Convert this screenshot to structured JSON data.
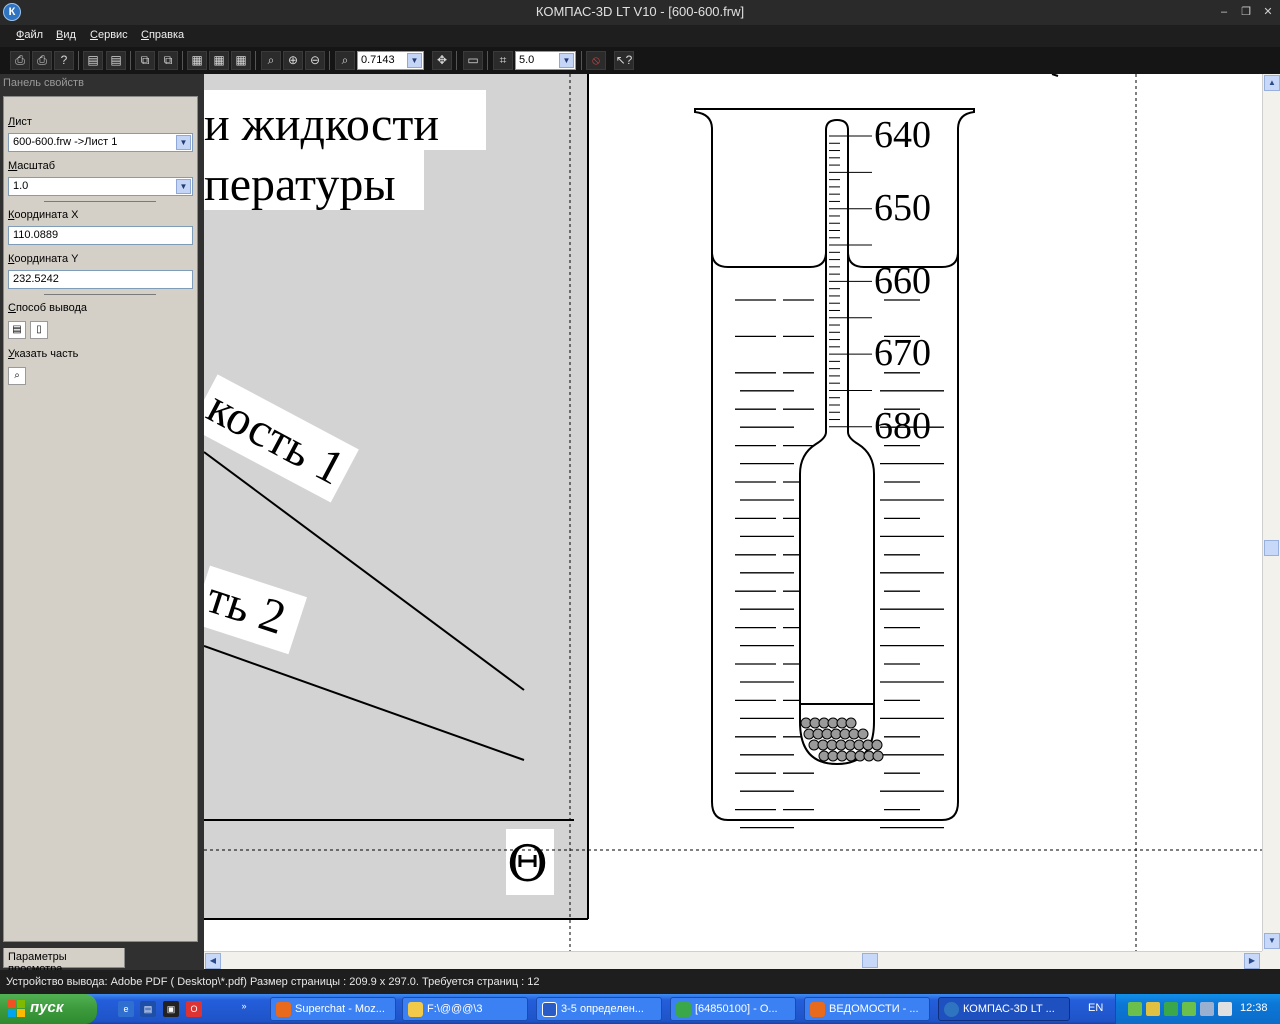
{
  "window": {
    "title": "КОМПАС-3D LT V10 - [600-600.frw]",
    "icon_text": "К",
    "controls": [
      "minimize-icon",
      "restore-icon",
      "close-icon"
    ]
  },
  "menu": [
    "Файл",
    "Вид",
    "Сервис",
    "Справка"
  ],
  "toolbar": {
    "zoom_value": "0.7143",
    "step_value": "5.0"
  },
  "panel": {
    "title": "Панель свойств",
    "sheet_label": "Лист",
    "sheet_value": "600-600.frw ->Лист 1",
    "scale_label": "Масштаб",
    "scale_value": "1.0",
    "coord_x_label": "Координата X",
    "coord_x_value": "110.0889",
    "coord_y_label": "Координата Y",
    "coord_y_value": "232.5242",
    "output_label": "Способ вывода",
    "part_label": "Указать часть",
    "tab_label": "Параметры просмотра"
  },
  "drawing": {
    "text_line1": "и жидкости",
    "text_line2": "пературы",
    "label_liquid1": "кость 1",
    "label_liquid2": "ть 2",
    "symbol": "Θ",
    "scale_marks": [
      "640",
      "650",
      "660",
      "670",
      "680"
    ]
  },
  "status": {
    "text": "Устройство вывода: Adobe PDF ( Desktop\\*.pdf)  Размер страницы : 209.9 x 297.0.  Требуется страниц : 12"
  },
  "taskbar": {
    "start_label": "пуск",
    "tasks": [
      {
        "label": "Superchat - Moz...",
        "color": "#e86a1c"
      },
      {
        "label": "F:\\@@@\\3",
        "color": "#f3c94a"
      },
      {
        "label": "3-5 определен...",
        "color": "#2a5cc8"
      },
      {
        "label": "[64850100] - О...",
        "color": "#3aa84a"
      },
      {
        "label": "ВЕДОМОСТИ - ...",
        "color": "#e86a1c"
      },
      {
        "label": "КОМПАС-3D LT ...",
        "color": "#2f74c0"
      }
    ],
    "lang": "EN",
    "clock": "12:38"
  }
}
